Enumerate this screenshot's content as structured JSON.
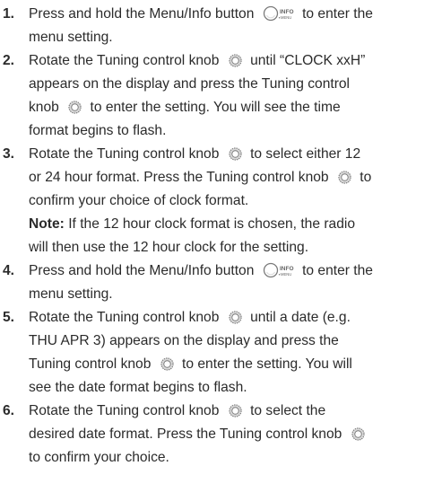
{
  "steps": [
    {
      "number": "1.",
      "lines": [
        [
          "Press and hold the Menu/Info button ",
          {
            "icon": "menu-info-button-icon"
          },
          " to enter the"
        ],
        [
          "menu setting."
        ]
      ]
    },
    {
      "number": "2.",
      "lines": [
        [
          "Rotate the Tuning control knob ",
          {
            "icon": "tuning-knob-icon"
          },
          " until “CLOCK xxH”"
        ],
        [
          "appears on the display and press the Tuning control"
        ],
        [
          "knob ",
          {
            "icon": "tuning-knob-icon"
          },
          " to enter the setting. You will see the time"
        ],
        [
          "format begins to flash."
        ]
      ]
    },
    {
      "number": "3.",
      "lines": [
        [
          "Rotate the Tuning control knob ",
          {
            "icon": "tuning-knob-icon"
          },
          " to select either 12"
        ],
        [
          "or 24 hour format. Press the Tuning control knob ",
          {
            "icon": "tuning-knob-icon"
          },
          " to"
        ],
        [
          "confirm your choice of clock format."
        ],
        [
          {
            "label": "Note:"
          },
          " If the 12 hour clock format is chosen, the radio"
        ],
        [
          "will then use the 12 hour clock for the setting."
        ]
      ]
    },
    {
      "number": "4.",
      "lines": [
        [
          "Press and hold the Menu/Info button ",
          {
            "icon": "menu-info-button-icon"
          },
          " to enter the"
        ],
        [
          "menu setting."
        ]
      ]
    },
    {
      "number": "5.",
      "lines": [
        [
          "Rotate the Tuning control knob ",
          {
            "icon": "tuning-knob-icon"
          },
          " until a date (e.g."
        ],
        [
          "THU APR 3) appears on the display and press the"
        ],
        [
          "Tuning control knob ",
          {
            "icon": "tuning-knob-icon"
          },
          " to enter the setting. You will"
        ],
        [
          "see the date format begins to flash."
        ]
      ]
    },
    {
      "number": "6.",
      "lines": [
        [
          "Rotate the Tuning control knob ",
          {
            "icon": "tuning-knob-icon"
          },
          " to select the"
        ],
        [
          "desired date format. Press the Tuning control knob ",
          {
            "icon": "tuning-knob-icon"
          }
        ],
        [
          "to confirm your choice."
        ]
      ]
    }
  ],
  "icons": {
    "menu_info_label_top": "INFO",
    "menu_info_label_bottom": "MENU"
  },
  "colors": {
    "text": "#2b2b2b",
    "icon_stroke": "#7a7a7a",
    "icon_fill": "#d9d9d9"
  }
}
